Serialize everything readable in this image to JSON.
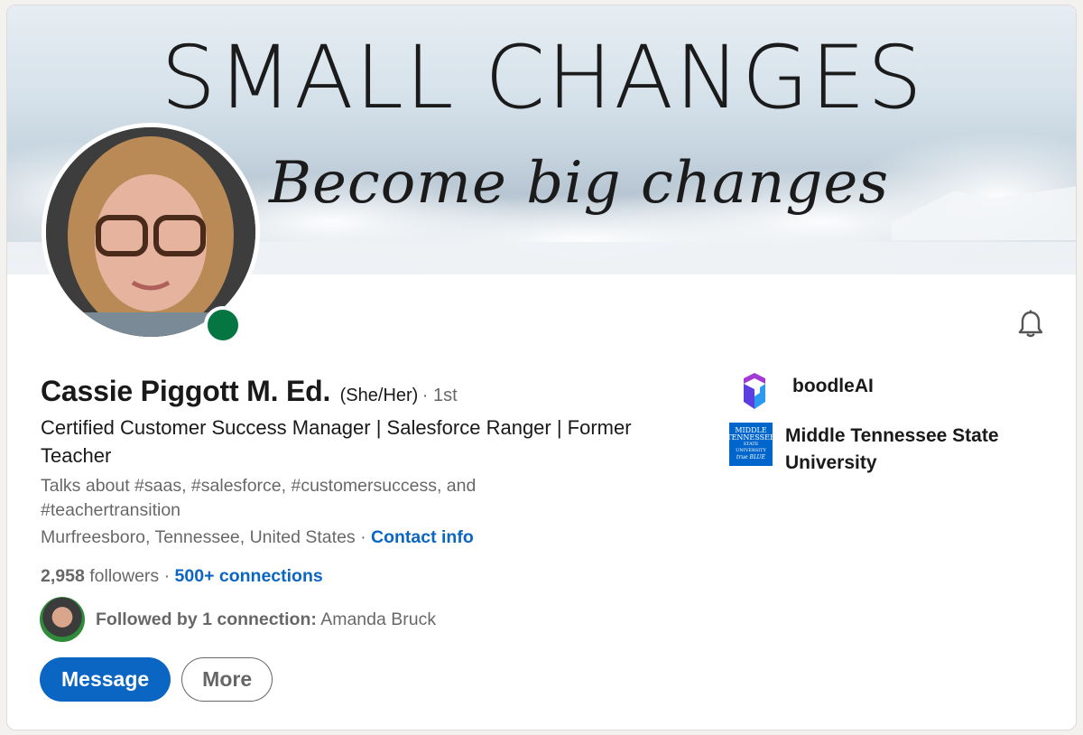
{
  "banner": {
    "title": "SMALL CHANGES",
    "subtitle": "Become big changes"
  },
  "profile": {
    "name": "Cassie Piggott M. Ed.",
    "pronouns": "(She/Her)",
    "degree": "· 1st",
    "headline": "Certified Customer Success Manager | Salesforce Ranger | Former Teacher",
    "talks_about": "Talks about #saas, #salesforce, #customersuccess, and #teachertransition",
    "location": "Murfreesboro, Tennessee, United States",
    "location_sep": " · ",
    "contact_label": "Contact info",
    "followers_count": "2,958",
    "followers_label": " followers",
    "stats_sep": " · ",
    "connections_label": "500+ connections",
    "mutual_prefix": "Followed by 1 connection:",
    "mutual_name": " Amanda Bruck",
    "online_status_color": "#057642"
  },
  "actions": {
    "message_label": "Message",
    "more_label": "More"
  },
  "orgs": [
    {
      "name": "boodleAI",
      "icon": "boodleai-logo"
    },
    {
      "name": "Middle Tennessee State University",
      "icon": "mtsu-logo",
      "logo_text": [
        "MIDDLE",
        "TENNESSEE",
        "STATE UNIVERSITY",
        "true BLUE"
      ]
    }
  ],
  "colors": {
    "accent": "#0a66c2",
    "online": "#057642"
  }
}
